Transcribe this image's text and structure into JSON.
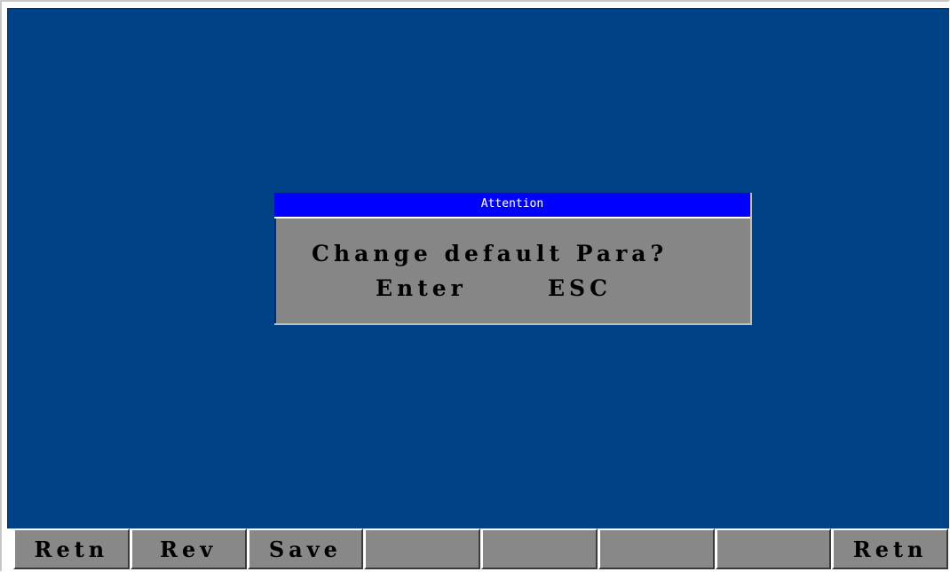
{
  "dialog": {
    "title": "Attention",
    "message": "Change default Para?",
    "enter_label": "Enter",
    "esc_label": "ESC"
  },
  "function_keys": [
    {
      "label": "Retn"
    },
    {
      "label": "Rev"
    },
    {
      "label": "Save"
    },
    {
      "label": ""
    },
    {
      "label": ""
    },
    {
      "label": ""
    },
    {
      "label": ""
    },
    {
      "label": "Retn"
    }
  ],
  "colors": {
    "workspace_background": "#004287",
    "dialog_titlebar": "#0000ff",
    "dialog_body": "#868686",
    "button_face": "#888888"
  }
}
